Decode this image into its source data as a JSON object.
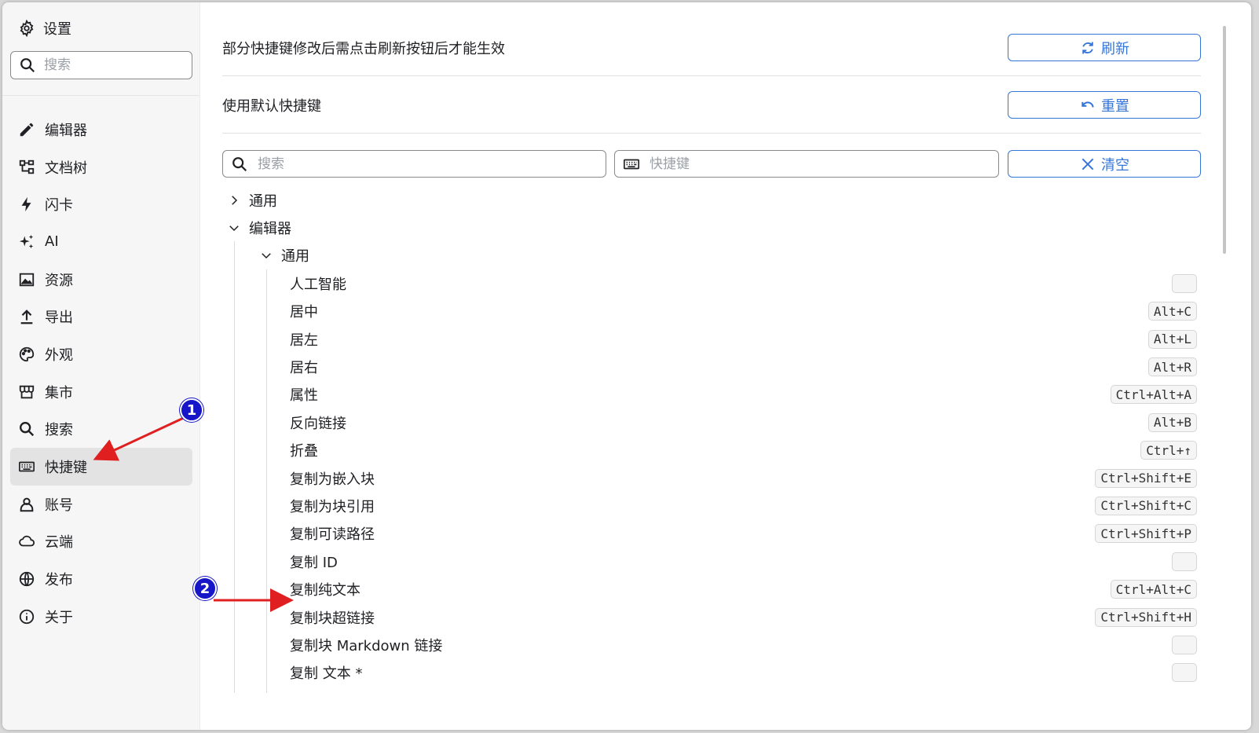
{
  "sidebar": {
    "title": "设置",
    "search_placeholder": "搜索",
    "items": [
      {
        "label": "编辑器",
        "icon": "pencil-icon"
      },
      {
        "label": "文档树",
        "icon": "tree-icon"
      },
      {
        "label": "闪卡",
        "icon": "lightning-icon"
      },
      {
        "label": "AI",
        "icon": "sparkle-icon"
      },
      {
        "label": "资源",
        "icon": "image-icon"
      },
      {
        "label": "导出",
        "icon": "upload-icon"
      },
      {
        "label": "外观",
        "icon": "palette-icon"
      },
      {
        "label": "集市",
        "icon": "store-icon"
      },
      {
        "label": "搜索",
        "icon": "search-icon"
      },
      {
        "label": "快捷键",
        "icon": "keyboard-icon",
        "active": true
      },
      {
        "label": "账号",
        "icon": "user-icon"
      },
      {
        "label": "云端",
        "icon": "cloud-icon"
      },
      {
        "label": "发布",
        "icon": "globe-icon"
      },
      {
        "label": "关于",
        "icon": "info-icon"
      }
    ]
  },
  "main": {
    "refresh_text": "部分快捷键修改后需点击刷新按钮后才能生效",
    "refresh_button": "刷新",
    "reset_text": "使用默认快捷键",
    "reset_button": "重置",
    "search_placeholder": "搜索",
    "keymap_placeholder": "快捷键",
    "clear_button": "清空"
  },
  "tree": {
    "general": "通用",
    "editor": "编辑器",
    "editor_general": "通用",
    "items": [
      {
        "label": "人工智能",
        "shortcut": ""
      },
      {
        "label": "居中",
        "shortcut": "Alt+C"
      },
      {
        "label": "居左",
        "shortcut": "Alt+L"
      },
      {
        "label": "居右",
        "shortcut": "Alt+R"
      },
      {
        "label": "属性",
        "shortcut": "Ctrl+Alt+A"
      },
      {
        "label": "反向链接",
        "shortcut": "Alt+B"
      },
      {
        "label": "折叠",
        "shortcut": "Ctrl+↑"
      },
      {
        "label": "复制为嵌入块",
        "shortcut": "Ctrl+Shift+E"
      },
      {
        "label": "复制为块引用",
        "shortcut": "Ctrl+Shift+C"
      },
      {
        "label": "复制可读路径",
        "shortcut": "Ctrl+Shift+P"
      },
      {
        "label": "复制 ID",
        "shortcut": ""
      },
      {
        "label": "复制纯文本",
        "shortcut": "Ctrl+Alt+C"
      },
      {
        "label": "复制块超链接",
        "shortcut": "Ctrl+Shift+H"
      },
      {
        "label": "复制块 Markdown 链接",
        "shortcut": ""
      },
      {
        "label": "复制 文本 *",
        "shortcut": ""
      }
    ]
  },
  "annotations": [
    {
      "number": "1"
    },
    {
      "number": "2"
    }
  ],
  "colors": {
    "accent": "#3575d8",
    "annotation_badge": "#1616c8",
    "annotation_arrow": "#e02020"
  }
}
